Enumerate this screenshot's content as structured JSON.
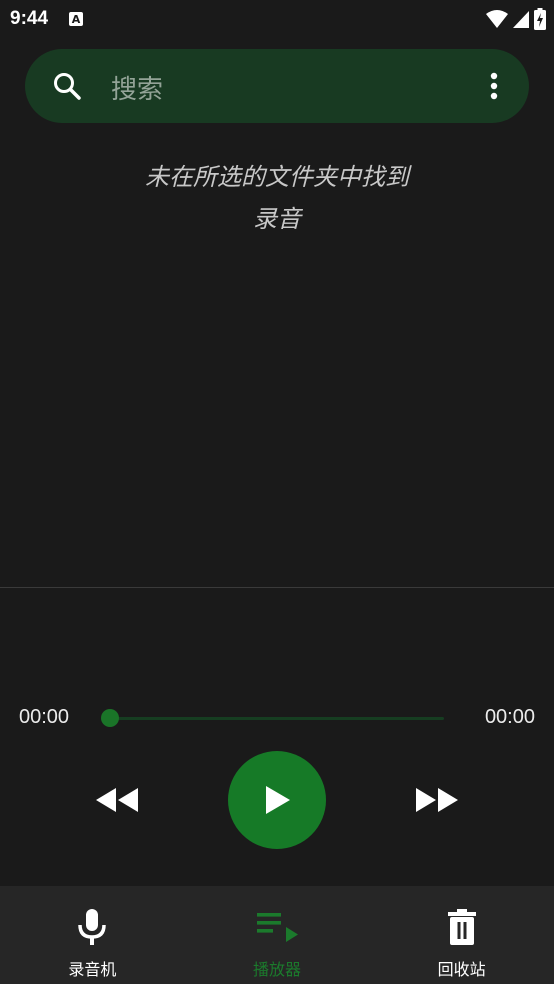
{
  "status_bar": {
    "time": "9:44"
  },
  "search": {
    "placeholder": "搜索"
  },
  "empty_state": {
    "line1": "未在所选的文件夹中找到",
    "line2": "录音"
  },
  "player": {
    "current_time": "00:00",
    "total_time": "00:00",
    "progress": 0
  },
  "bottom_nav": {
    "items": [
      {
        "label": "录音机",
        "icon": "microphone-icon",
        "active": false
      },
      {
        "label": "播放器",
        "icon": "playlist-play-icon",
        "active": true
      },
      {
        "label": "回收站",
        "icon": "trash-icon",
        "active": false
      }
    ]
  },
  "colors": {
    "background": "#1a1a1a",
    "search_bg": "#183a22",
    "accent": "#167a27",
    "nav_bg": "#262626",
    "active_nav": "#1b7a2c"
  }
}
